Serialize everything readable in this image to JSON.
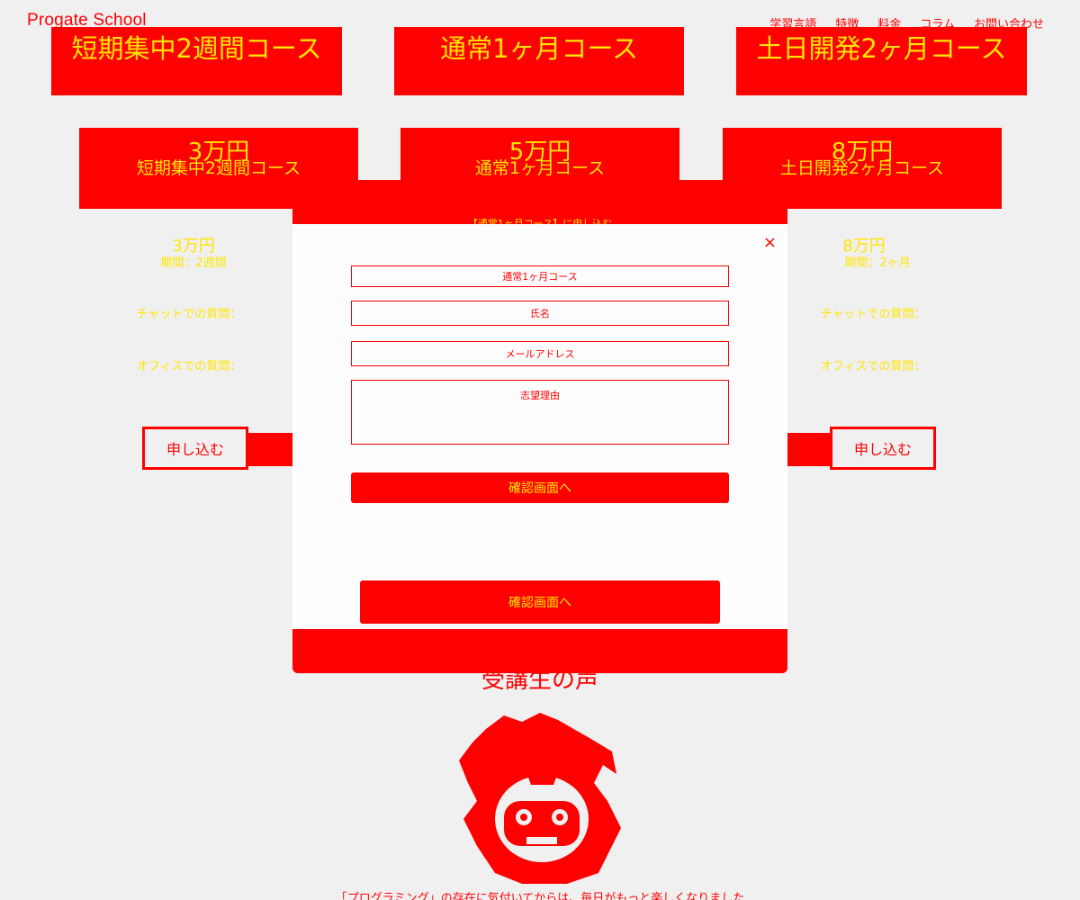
{
  "header": {
    "logo": "Progate School",
    "nav": [
      "学習言語",
      "特徴",
      "料金",
      "コラム",
      "お問い合わせ"
    ]
  },
  "courses": [
    {
      "top_title": "短期集中2週間コース",
      "price": "3万円",
      "name": "短期集中2週間コース",
      "price_small": "3万円",
      "period": "期間：2週間",
      "chat": "チャットでの質問：",
      "office": "オフィスでの質問：",
      "apply": "申し込む"
    },
    {
      "top_title": "通常1ヶ月コース",
      "price": "5万円",
      "name": "通常1ヶ月コース",
      "banner": "【通常1ヶ月コース】に申し込む"
    },
    {
      "top_title": "土日開発2ヶ月コース",
      "price": "8万円",
      "name": "土日開発2ヶ月コース",
      "price_small": "8万円",
      "period": "期間：2ヶ月",
      "chat": "チャットでの質問：",
      "office": "オフィスでの質問：",
      "apply": "申し込む"
    }
  ],
  "modal": {
    "title": "【通常1ヶ月コース】に申し込む",
    "course_field": "通常1ヶ月コース",
    "name_label": "氏名",
    "email_label": "メールアドレス",
    "reason_label": "志望理由",
    "submit": "確認画面へ",
    "confirm": "確認画面へ",
    "close": "×"
  },
  "voice": {
    "heading": "受講生の声",
    "quote": "「プログラミング」の存在に気付いてからは、毎日がもっと楽しくなりました"
  }
}
